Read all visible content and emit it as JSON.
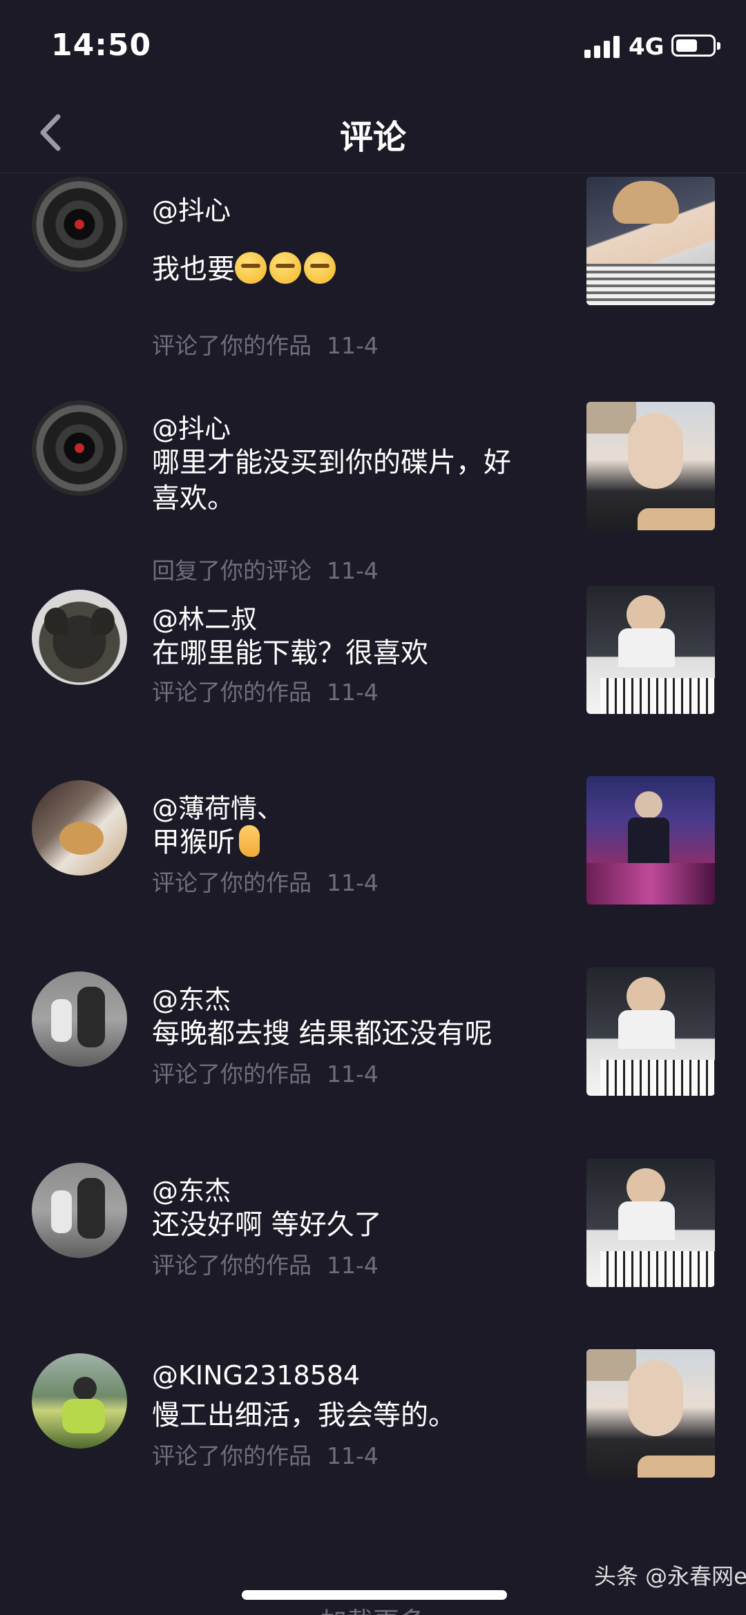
{
  "status_bar": {
    "time": "14:50",
    "network": "4G"
  },
  "header": {
    "title": "评论"
  },
  "comments": [
    {
      "user": "@抖心",
      "text": "我也要",
      "emoji": [
        "grimace-emoji",
        "grimace-emoji",
        "grimace-emoji"
      ],
      "action": "评论了你的作品",
      "date": "11-4"
    },
    {
      "user": "@抖心",
      "text": "哪里才能没买到你的碟片，好喜欢。",
      "action": "回复了你的评论",
      "date": "11-4"
    },
    {
      "user": "@林二叔",
      "text": "在哪里能下载？很喜欢",
      "action": "评论了你的作品",
      "date": "11-4"
    },
    {
      "user": "@薄荷情、",
      "text": "甲猴听",
      "emoji": [
        "ear-emoji"
      ],
      "action": "评论了你的作品",
      "date": "11-4"
    },
    {
      "user": "@东杰",
      "text": "每晚都去搜 结果都还没有呢",
      "action": "评论了你的作品",
      "date": "11-4"
    },
    {
      "user": "@东杰",
      "text": "还没好啊 等好久了",
      "action": "评论了你的作品",
      "date": "11-4"
    },
    {
      "user": "@KING2318584",
      "text": "慢工出细活，我会等的。",
      "action": "评论了你的作品",
      "date": "11-4"
    }
  ],
  "footer": {
    "load_more": "加载更多",
    "watermark": "头条 @永春网e"
  },
  "colors": {
    "background": "#1b1a26",
    "meta_text": "#6f6e7c",
    "text": "#ffffff"
  }
}
